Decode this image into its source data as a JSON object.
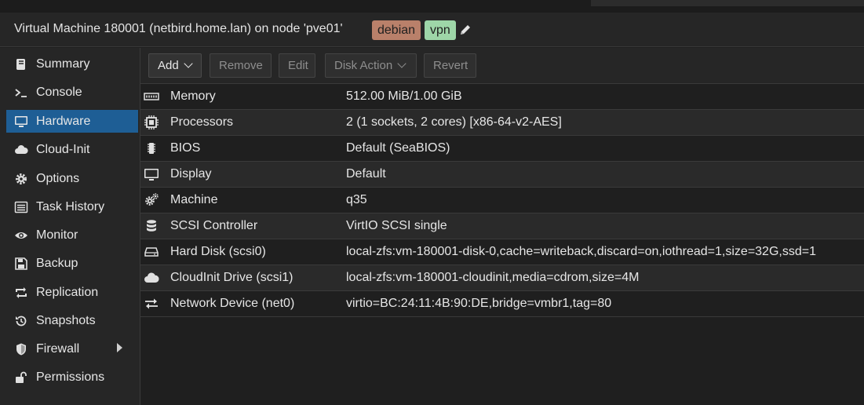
{
  "header": {
    "title": "Virtual Machine 180001 (netbird.home.lan) on node 'pve01'",
    "tags": [
      {
        "label": "debian",
        "color": "#b9806a"
      },
      {
        "label": "vpn",
        "color": "#9ed6a8"
      }
    ],
    "edit_icon": "pencil-icon"
  },
  "sidebar": {
    "active": "Hardware",
    "items": [
      {
        "label": "Summary",
        "icon": "book-icon"
      },
      {
        "label": "Console",
        "icon": "terminal-icon"
      },
      {
        "label": "Hardware",
        "icon": "desktop-icon"
      },
      {
        "label": "Cloud-Init",
        "icon": "cloud-icon"
      },
      {
        "label": "Options",
        "icon": "gear-icon"
      },
      {
        "label": "Task History",
        "icon": "list-icon"
      },
      {
        "label": "Monitor",
        "icon": "eye-icon"
      },
      {
        "label": "Backup",
        "icon": "floppy-icon"
      },
      {
        "label": "Replication",
        "icon": "retweet-icon"
      },
      {
        "label": "Snapshots",
        "icon": "history-icon"
      },
      {
        "label": "Firewall",
        "icon": "shield-icon"
      },
      {
        "label": "Permissions",
        "icon": "unlock-icon"
      }
    ]
  },
  "toolbar": {
    "add": "Add",
    "remove": "Remove",
    "edit": "Edit",
    "disk_action": "Disk Action",
    "revert": "Revert"
  },
  "hardware": [
    {
      "name": "Memory",
      "value": "512.00 MiB/1.00 GiB",
      "icon": "memory-icon"
    },
    {
      "name": "Processors",
      "value": "2 (1 sockets, 2 cores) [x86-64-v2-AES]",
      "icon": "cpu-icon"
    },
    {
      "name": "BIOS",
      "value": "Default (SeaBIOS)",
      "icon": "microchip-icon"
    },
    {
      "name": "Display",
      "value": "Default",
      "icon": "desktop-icon"
    },
    {
      "name": "Machine",
      "value": "q35",
      "icon": "cogs-icon"
    },
    {
      "name": "SCSI Controller",
      "value": "VirtIO SCSI single",
      "icon": "database-icon"
    },
    {
      "name": "Hard Disk (scsi0)",
      "value": "local-zfs:vm-180001-disk-0,cache=writeback,discard=on,iothread=1,size=32G,ssd=1",
      "icon": "hdd-icon"
    },
    {
      "name": "CloudInit Drive (scsi1)",
      "value": "local-zfs:vm-180001-cloudinit,media=cdrom,size=4M",
      "icon": "cloud-icon"
    },
    {
      "name": "Network Device (net0)",
      "value": "virtio=BC:24:11:4B:90:DE,bridge=vmbr1,tag=80",
      "icon": "exchange-icon"
    }
  ]
}
